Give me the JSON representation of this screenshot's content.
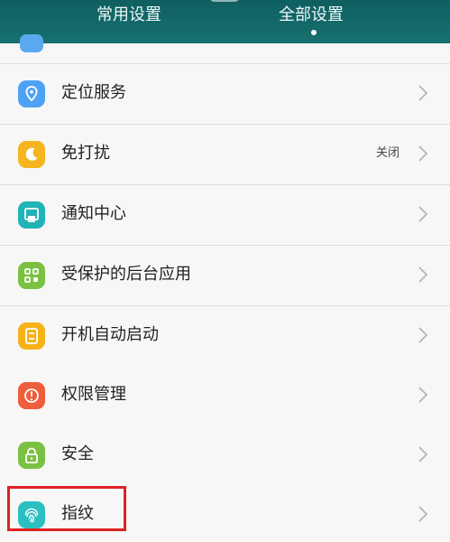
{
  "header": {
    "tabs": [
      {
        "label": "常用设置",
        "selected": false
      },
      {
        "label": "全部设置",
        "selected": true
      }
    ]
  },
  "settings": {
    "items": [
      {
        "label": "定位服务",
        "value": "",
        "icon": "location-icon",
        "color": "#4ea2f3"
      },
      {
        "label": "免打扰",
        "value": "关闭",
        "icon": "moon-icon",
        "color": "#f4b51e"
      },
      {
        "label": "通知中心",
        "value": "",
        "icon": "notification-icon",
        "color": "#20b4b7"
      },
      {
        "label": "受保护的后台应用",
        "value": "",
        "icon": "protected-apps-icon",
        "color": "#7ac142"
      },
      {
        "label": "开机自动启动",
        "value": "",
        "icon": "startup-icon",
        "color": "#f7b21a"
      },
      {
        "label": "权限管理",
        "value": "",
        "icon": "permission-icon",
        "color": "#f05d3b"
      },
      {
        "label": "安全",
        "value": "",
        "icon": "lock-icon",
        "color": "#7ac142"
      },
      {
        "label": "指纹",
        "value": "",
        "icon": "fingerprint-icon",
        "color": "#2cbfc0"
      }
    ]
  },
  "highlight": {
    "color": "#e02124"
  }
}
